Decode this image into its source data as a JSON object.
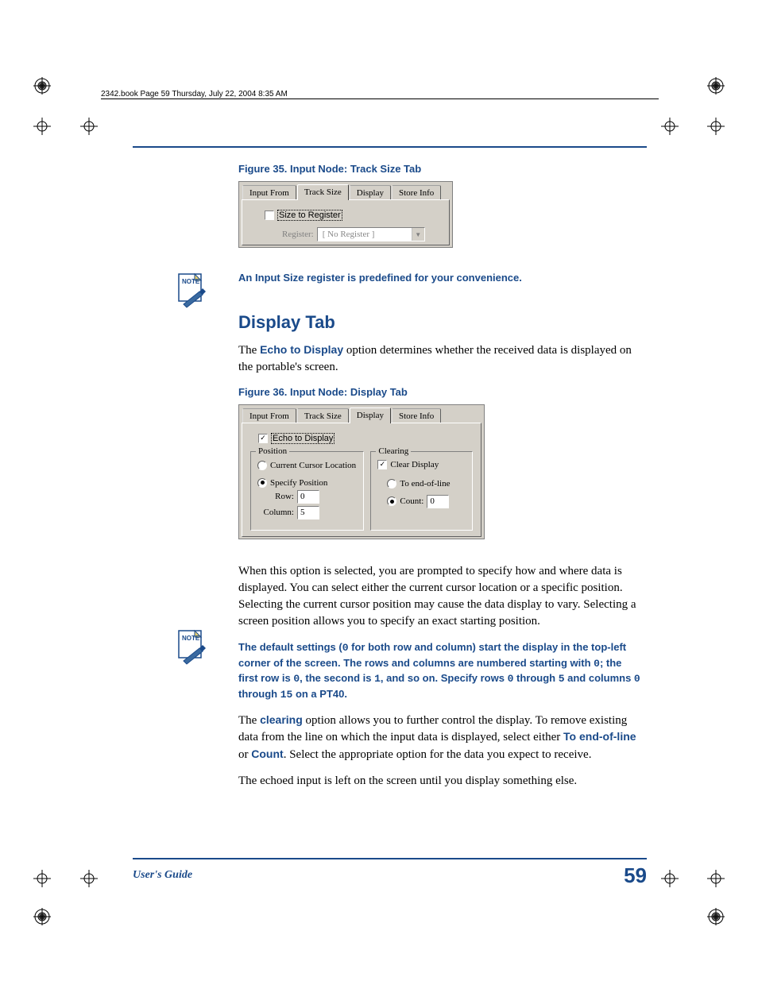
{
  "header_line": "2342.book  Page 59  Thursday, July 22, 2004  8:35 AM",
  "fig35": {
    "caption": "Figure 35. Input Node: Track Size Tab",
    "tabs": [
      "Input From",
      "Track Size",
      "Display",
      "Store Info"
    ],
    "active_tab": 1,
    "size_to_register_checked": false,
    "size_to_register_label": "Size to Register",
    "register_label": "Register:",
    "register_value": "[ No Register ]"
  },
  "note1": "An Input Size register is predefined for your convenience.",
  "note1_bold": "Input Size",
  "section_title": "Display Tab",
  "intro_para_pre": "The ",
  "intro_bold": "Echo to Display",
  "intro_para_post": " option determines whether the received data is displayed on the portable's screen.",
  "fig36": {
    "caption": "Figure 36. Input Node: Display Tab",
    "tabs": [
      "Input From",
      "Track Size",
      "Display",
      "Store Info"
    ],
    "active_tab": 2,
    "echo_label": "Echo to Display",
    "echo_checked": true,
    "position": {
      "legend": "Position",
      "current_label": "Current Cursor Location",
      "current_sel": false,
      "specify_label": "Specify Position",
      "specify_sel": true,
      "row_label": "Row:",
      "row_value": "0",
      "col_label": "Column:",
      "col_value": "5"
    },
    "clearing": {
      "legend": "Clearing",
      "clear_label": "Clear Display",
      "clear_checked": true,
      "eol_label": "To end-of-line",
      "eol_sel": false,
      "count_label": "Count:",
      "count_sel": true,
      "count_value": "0"
    }
  },
  "para2": "When this option is selected, you are prompted to specify how and where data is displayed. You can select either the current cursor location or a specific position. Selecting the current cursor position may cause the data display to vary. Selecting a screen position allows you to specify an exact starting position.",
  "note2_full": "The default settings (0 for both row and column) start the display in the top-left corner of the screen. The rows and columns are numbered starting with 0; the first row is 0, the second is 1, and so on. Specify rows 0 through 5 and columns 0 through 15 on a PT40.",
  "para3_pre": "The ",
  "para3_b1": "clearing",
  "para3_mid": " option allows you to further control the display. To remove existing data from the line on which the input data is displayed, select either ",
  "para3_b2": "To end-of-line",
  "para3_or": " or ",
  "para3_b3": "Count",
  "para3_post": ". Select the appropriate option for the data you expect to receive.",
  "para4": "The echoed input is left on the screen until you display something else.",
  "footer_left": "User's Guide",
  "page_number": "59"
}
